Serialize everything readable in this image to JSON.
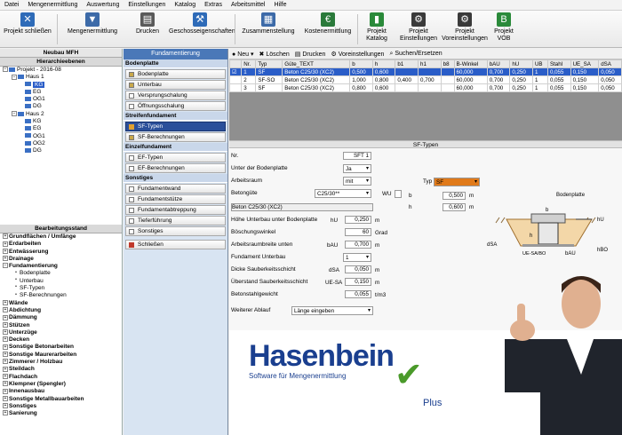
{
  "menu": [
    "Datei",
    "Mengenermittlung",
    "Auswertung",
    "Einstellungen",
    "Katalog",
    "Extras",
    "Arbeitsmittel",
    "Hilfe"
  ],
  "toolbar": {
    "close_project": "Projekt schließen",
    "quantity_calc": "Mengenermittlung",
    "print": "Drucken",
    "floor_props": "Geschosseigenschaften",
    "summary": "Zusammenstellung",
    "cost_calc": "Kostenermittlung",
    "project_catalog_1": "Projekt",
    "project_catalog_2": "Katalog",
    "project_settings_1": "Projekt",
    "project_settings_2": "Einstellungen",
    "project_presets_1": "Projekt",
    "project_presets_2": "Voreinstellungen",
    "project_vob_1": "Projekt",
    "project_vob_2": "VOB"
  },
  "left": {
    "title": "Neubau MFH",
    "hierarchy_header": "Hierarchieebenen",
    "tree": [
      {
        "label": "Projekt - 2016-08",
        "level": 0,
        "type": "root"
      },
      {
        "label": "Haus 1",
        "level": 1,
        "type": "house"
      },
      {
        "label": "KG",
        "level": 2,
        "type": "floor",
        "selected": true
      },
      {
        "label": "EG",
        "level": 2,
        "type": "floor"
      },
      {
        "label": "OG1",
        "level": 2,
        "type": "floor"
      },
      {
        "label": "DG",
        "level": 2,
        "type": "floor"
      },
      {
        "label": "Haus 2",
        "level": 1,
        "type": "house"
      },
      {
        "label": "KG",
        "level": 2,
        "type": "floor"
      },
      {
        "label": "EG",
        "level": 2,
        "type": "floor"
      },
      {
        "label": "OG1",
        "level": 2,
        "type": "floor"
      },
      {
        "label": "OG2",
        "level": 2,
        "type": "floor"
      },
      {
        "label": "DG",
        "level": 2,
        "type": "floor"
      }
    ],
    "status_header": "Bearbeitungsstand",
    "status": [
      {
        "label": "Grundflächen / Umfänge",
        "level": 0
      },
      {
        "label": "Erdarbeiten",
        "level": 0
      },
      {
        "label": "Entwässerung",
        "level": 0
      },
      {
        "label": "Drainage",
        "level": 0
      },
      {
        "label": "Fundamentierung",
        "level": 0,
        "expanded": true
      },
      {
        "label": "Bodenplatte",
        "level": 1
      },
      {
        "label": "Unterbau",
        "level": 1
      },
      {
        "label": "SF-Typen",
        "level": 1
      },
      {
        "label": "SF-Berechnungen",
        "level": 1
      },
      {
        "label": "Wände",
        "level": 0
      },
      {
        "label": "Abdichtung",
        "level": 0
      },
      {
        "label": "Dämmung",
        "level": 0
      },
      {
        "label": "Stützen",
        "level": 0
      },
      {
        "label": "Unterzüge",
        "level": 0
      },
      {
        "label": "Decken",
        "level": 0
      },
      {
        "label": "Sonstige Betonarbeiten",
        "level": 0
      },
      {
        "label": "Sonstige Maurerarbeiten",
        "level": 0
      },
      {
        "label": "Zimmerer / Holzbau",
        "level": 0
      },
      {
        "label": "Steildach",
        "level": 0
      },
      {
        "label": "Flachdach",
        "level": 0
      },
      {
        "label": "Klempner (Spengler)",
        "level": 0
      },
      {
        "label": "Innenausbau",
        "level": 0
      },
      {
        "label": "Sonstige Metallbauarbeiten",
        "level": 0
      },
      {
        "label": "Sonstiges",
        "level": 0
      },
      {
        "label": "Sanierung",
        "level": 0
      }
    ]
  },
  "middle": {
    "title": "Fundamentierung",
    "groups": [
      {
        "label": "Bodenplatte",
        "items": [
          {
            "label": "Bodenplatte",
            "checked": true
          },
          {
            "label": "Unterbau",
            "checked": true
          },
          {
            "label": "Versprungschalung"
          },
          {
            "label": "Öffnungsschalung"
          }
        ]
      },
      {
        "label": "Streifenfundament",
        "items": [
          {
            "label": "SF-Typen",
            "active": true
          },
          {
            "label": "SF-Berechnungen",
            "checked": true
          }
        ]
      },
      {
        "label": "Einzelfundament",
        "items": [
          {
            "label": "EF-Typen"
          },
          {
            "label": "EF-Berechnungen"
          }
        ]
      },
      {
        "label": "Sonstiges",
        "items": [
          {
            "label": "Fundamentwand"
          },
          {
            "label": "Fundamentstütze"
          },
          {
            "label": "Fundamentabtreppung"
          },
          {
            "label": "Tieferführung"
          },
          {
            "label": "Sonstiges"
          }
        ]
      }
    ],
    "close_label": "Schließen"
  },
  "right": {
    "tools": {
      "new": "Neu",
      "delete": "Löschen",
      "print": "Drucken",
      "presets": "Voreinstellungen",
      "search": "Suchen/Ersetzen"
    },
    "columns": [
      "",
      "Nr.",
      "Typ",
      "Güte_TEXT",
      "b",
      "h",
      "b1",
      "h1",
      "b8",
      "B-Winkel",
      "bAU",
      "hU",
      "UB",
      "Stahl",
      "UE_SA",
      "dSA"
    ],
    "rows": [
      [
        "☑",
        "1",
        "SF",
        "Beton C25/30 (XC2)",
        "0,500",
        "0,600",
        "",
        "",
        "",
        "60,000",
        "0,700",
        "0,250",
        "1",
        "0,055",
        "0,150",
        "0,050"
      ],
      [
        "",
        "2",
        "SF-SO",
        "Beton C25/30 (XC2)",
        "1,000",
        "0,800",
        "0,400",
        "0,700",
        "",
        "60,000",
        "0,700",
        "0,250",
        "1",
        "0,055",
        "0,150",
        "0,050"
      ],
      [
        "",
        "3",
        "SF",
        "Beton C25/30 (XC2)",
        "0,800",
        "0,600",
        "",
        "",
        "",
        "60,000",
        "0,700",
        "0,250",
        "1",
        "0,055",
        "0,150",
        "0,050"
      ]
    ],
    "section_title": "SF-Typen",
    "form": {
      "nr_label": "Nr.",
      "nr_value": "SFT 1",
      "under_slab_label": "Unter der Bodenplatte",
      "under_slab_value": "Ja",
      "workspace_label": "Arbeitsraum",
      "workspace_value": "mit",
      "concrete_label": "Betongüte",
      "concrete_value": "C25/30**",
      "wu_label": "WU",
      "concrete_text": "Beton C25/30 (XC2)",
      "typ_label": "Typ",
      "typ_value": "SF",
      "b_label": "b",
      "b_value": "0,500",
      "h_label": "h",
      "h_value": "0,600",
      "m": "m",
      "base_height_label": "Höhe Unterbau unter Bodenplatte",
      "base_height_sym": "hU",
      "base_height_value": "0,250",
      "slope_label": "Böschungswinkel",
      "slope_value": "60",
      "slope_unit": "Grad",
      "workwidth_label": "Arbeitsraumbreite unten",
      "workwidth_sym": "bAU",
      "workwidth_value": "0,700",
      "base_label": "Fundament Unterbau",
      "base_value": "1",
      "clean_label": "Dicke Sauberkeitsschicht",
      "clean_sym": "dSA",
      "clean_value": "0,050",
      "overhang_label": "Überstand Sauberkeitsschicht",
      "overhang_sym": "UE-SA",
      "overhang_value": "0,150",
      "steel_label": "Betonstahlgewicht",
      "steel_value": "0,055",
      "steel_unit": "t/m3",
      "next_label": "Weiterer Ablauf",
      "next_value": "Länge eingeben"
    },
    "diagram_labels": {
      "slab": "Bodenplatte",
      "b": "b",
      "h": "h",
      "hu": "hU",
      "dsa": "dSA",
      "ue": "UE-SA/BO",
      "bau": "bAU",
      "hbo": "hBO"
    }
  },
  "brand": {
    "name": "Hasenbein",
    "tagline": "Software für Mengenermittlung",
    "plus": "Plus"
  },
  "colors": {
    "accent": "#2a5dc8",
    "brand_blue": "#1a3f8f",
    "brand_green": "#4a9a2a"
  }
}
